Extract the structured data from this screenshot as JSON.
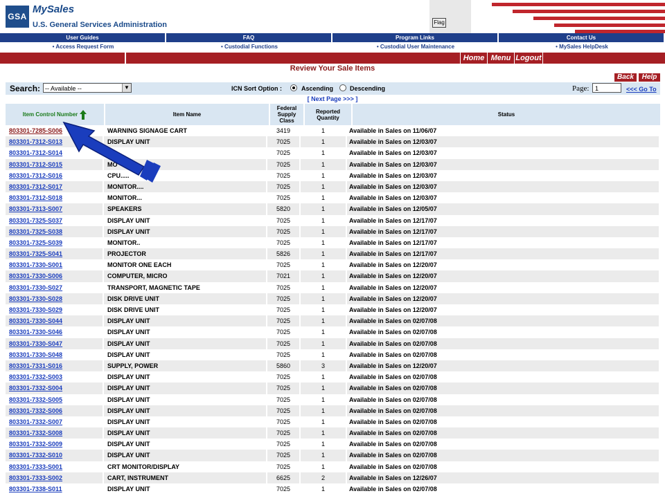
{
  "header": {
    "logo": "GSA",
    "app_title": "MySales",
    "agency": "U.S. General Services Administration",
    "flag_label": "Flag"
  },
  "nav_top": [
    "User Guides",
    "FAQ",
    "Program Links",
    "Contact Us"
  ],
  "nav_sub": [
    "• Access Request Form",
    "• Custodial Functions",
    "• Custodial User Maintenance",
    "• MySales HelpDesk"
  ],
  "actions": {
    "home": "Home",
    "menu": "Menu",
    "logout": "Logout",
    "back": "Back",
    "help": "Help"
  },
  "page_title": "Review Your Sale Items",
  "search": {
    "label": "Search:",
    "selected": "-- Available --",
    "sort_label": "ICN Sort Option :",
    "ascending": "Ascending",
    "descending": "Descending",
    "page_label": "Page:",
    "page_value": "1",
    "goto": "<<< Go To",
    "next": "[ Next Page >>> ]"
  },
  "columns": {
    "icn": "Item Control Number",
    "name": "Item Name",
    "fsc": "Federal Supply Class",
    "qty": "Reported Quantity",
    "status": "Status"
  },
  "rows": [
    {
      "icn": "803301-7285-S006",
      "name": "WARNING SIGNAGE CART",
      "fsc": "3419",
      "qty": "1",
      "status": "Available in Sales on 11/06/07"
    },
    {
      "icn": "803301-7312-S013",
      "name": "DISPLAY UNIT",
      "fsc": "7025",
      "qty": "1",
      "status": "Available in Sales on 12/03/07"
    },
    {
      "icn": "803301-7312-S014",
      "name": "",
      "fsc": "7025",
      "qty": "1",
      "status": "Available in Sales on 12/03/07"
    },
    {
      "icn": "803301-7312-S015",
      "name": "MO",
      "fsc": "7025",
      "qty": "1",
      "status": "Available in Sales on 12/03/07"
    },
    {
      "icn": "803301-7312-S016",
      "name": "CPU.....",
      "fsc": "7025",
      "qty": "1",
      "status": "Available in Sales on 12/03/07"
    },
    {
      "icn": "803301-7312-S017",
      "name": "MONITOR....",
      "fsc": "7025",
      "qty": "1",
      "status": "Available in Sales on 12/03/07"
    },
    {
      "icn": "803301-7312-S018",
      "name": "MONITOR...",
      "fsc": "7025",
      "qty": "1",
      "status": "Available in Sales on 12/03/07"
    },
    {
      "icn": "803301-7313-S007",
      "name": "SPEAKERS",
      "fsc": "5820",
      "qty": "1",
      "status": "Available in Sales on 12/05/07"
    },
    {
      "icn": "803301-7325-S037",
      "name": "DISPLAY UNIT",
      "fsc": "7025",
      "qty": "1",
      "status": "Available in Sales on 12/17/07"
    },
    {
      "icn": "803301-7325-S038",
      "name": "DISPLAY UNIT",
      "fsc": "7025",
      "qty": "1",
      "status": "Available in Sales on 12/17/07"
    },
    {
      "icn": "803301-7325-S039",
      "name": "MONITOR..",
      "fsc": "7025",
      "qty": "1",
      "status": "Available in Sales on 12/17/07"
    },
    {
      "icn": "803301-7325-S041",
      "name": "PROJECTOR",
      "fsc": "5826",
      "qty": "1",
      "status": "Available in Sales on 12/17/07"
    },
    {
      "icn": "803301-7330-S001",
      "name": "MONITOR ONE EACH",
      "fsc": "7025",
      "qty": "1",
      "status": "Available in Sales on 12/20/07"
    },
    {
      "icn": "803301-7330-S006",
      "name": "COMPUTER, MICRO",
      "fsc": "7021",
      "qty": "1",
      "status": "Available in Sales on 12/20/07"
    },
    {
      "icn": "803301-7330-S027",
      "name": "TRANSPORT, MAGNETIC TAPE",
      "fsc": "7025",
      "qty": "1",
      "status": "Available in Sales on 12/20/07"
    },
    {
      "icn": "803301-7330-S028",
      "name": "DISK DRIVE UNIT",
      "fsc": "7025",
      "qty": "1",
      "status": "Available in Sales on 12/20/07"
    },
    {
      "icn": "803301-7330-S029",
      "name": "DISK DRIVE UNIT",
      "fsc": "7025",
      "qty": "1",
      "status": "Available in Sales on 12/20/07"
    },
    {
      "icn": "803301-7330-S044",
      "name": "DISPLAY UNIT",
      "fsc": "7025",
      "qty": "1",
      "status": "Available in Sales on 02/07/08"
    },
    {
      "icn": "803301-7330-S046",
      "name": "DISPLAY UNIT",
      "fsc": "7025",
      "qty": "1",
      "status": "Available in Sales on 02/07/08"
    },
    {
      "icn": "803301-7330-S047",
      "name": "DISPLAY UNIT",
      "fsc": "7025",
      "qty": "1",
      "status": "Available in Sales on 02/07/08"
    },
    {
      "icn": "803301-7330-S048",
      "name": "DISPLAY UNIT",
      "fsc": "7025",
      "qty": "1",
      "status": "Available in Sales on 02/07/08"
    },
    {
      "icn": "803301-7331-S016",
      "name": "SUPPLY, POWER",
      "fsc": "5860",
      "qty": "3",
      "status": "Available in Sales on 12/20/07"
    },
    {
      "icn": "803301-7332-S003",
      "name": "DISPLAY UNIT",
      "fsc": "7025",
      "qty": "1",
      "status": "Available in Sales on 02/07/08"
    },
    {
      "icn": "803301-7332-S004",
      "name": "DISPLAY UNIT",
      "fsc": "7025",
      "qty": "1",
      "status": "Available in Sales on 02/07/08"
    },
    {
      "icn": "803301-7332-S005",
      "name": "DISPLAY UNIT",
      "fsc": "7025",
      "qty": "1",
      "status": "Available in Sales on 02/07/08"
    },
    {
      "icn": "803301-7332-S006",
      "name": "DISPLAY UNIT",
      "fsc": "7025",
      "qty": "1",
      "status": "Available in Sales on 02/07/08"
    },
    {
      "icn": "803301-7332-S007",
      "name": "DISPLAY UNIT",
      "fsc": "7025",
      "qty": "1",
      "status": "Available in Sales on 02/07/08"
    },
    {
      "icn": "803301-7332-S008",
      "name": "DISPLAY UNIT",
      "fsc": "7025",
      "qty": "1",
      "status": "Available in Sales on 02/07/08"
    },
    {
      "icn": "803301-7332-S009",
      "name": "DISPLAY UNIT",
      "fsc": "7025",
      "qty": "1",
      "status": "Available in Sales on 02/07/08"
    },
    {
      "icn": "803301-7332-S010",
      "name": "DISPLAY UNIT",
      "fsc": "7025",
      "qty": "1",
      "status": "Available in Sales on 02/07/08"
    },
    {
      "icn": "803301-7333-S001",
      "name": "CRT MONITOR/DISPLAY",
      "fsc": "7025",
      "qty": "1",
      "status": "Available in Sales on 02/07/08"
    },
    {
      "icn": "803301-7333-S002",
      "name": "CART, INSTRUMENT",
      "fsc": "6625",
      "qty": "2",
      "status": "Available in Sales on 12/26/07"
    },
    {
      "icn": "803301-7338-S011",
      "name": "DISPLAY UNIT",
      "fsc": "7025",
      "qty": "1",
      "status": "Available in Sales on 02/07/08"
    }
  ],
  "colors": {
    "nav_blue": "#1f3f8a",
    "brand_red": "#a51f24",
    "header_band": "#d9e6f2",
    "link": "#1a3dbd",
    "arrow": "#1a3dbd"
  },
  "icons": {
    "sort": "green-up-arrow-icon",
    "pointer": "callout-arrow-icon"
  }
}
